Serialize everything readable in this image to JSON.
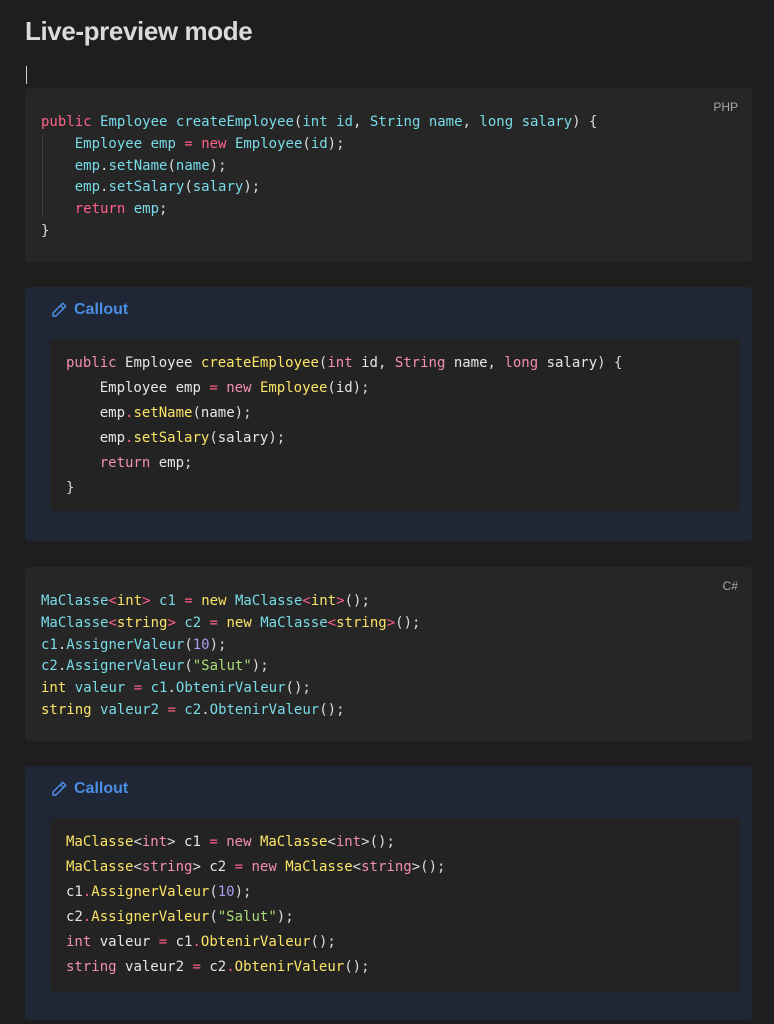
{
  "page": {
    "title": "Live-preview mode"
  },
  "blocks": [
    {
      "type": "code",
      "language": "PHP",
      "lines": [
        "public Employee createEmployee(int id, String name, long salary) {",
        "    Employee emp = new Employee(id);",
        "    emp.setName(name);",
        "    emp.setSalary(salary);",
        "    return emp;",
        "}"
      ]
    },
    {
      "type": "callout",
      "title": "Callout",
      "icon": "pencil-icon",
      "lines": [
        "public Employee createEmployee(int id, String name, long salary) {",
        "    Employee emp = new Employee(id);",
        "    emp.setName(name);",
        "    emp.setSalary(salary);",
        "    return emp;",
        "}"
      ]
    },
    {
      "type": "code",
      "language": "C#",
      "lines": [
        "MaClasse<int> c1 = new MaClasse<int>();",
        "MaClasse<string> c2 = new MaClasse<string>();",
        "c1.AssignerValeur(10);",
        "c2.AssignerValeur(\"Salut\");",
        "int valeur = c1.ObtenirValeur();",
        "string valeur2 = c2.ObtenirValeur();"
      ]
    },
    {
      "type": "callout",
      "title": "Callout",
      "icon": "pencil-icon",
      "lines": [
        "MaClasse<int> c1 = new MaClasse<int>();",
        "MaClasse<string> c2 = new MaClasse<string>();",
        "c1.AssignerValeur(10);",
        "c2.AssignerValeur(\"Salut\");",
        "int valeur = c1.ObtenirValeur();",
        "string valeur2 = c2.ObtenirValeur();"
      ]
    }
  ],
  "colors": {
    "background": "#1e1e1e",
    "code_bg": "#262626",
    "callout_bg": "#1f2636",
    "callout_title": "#4b8fe4"
  }
}
